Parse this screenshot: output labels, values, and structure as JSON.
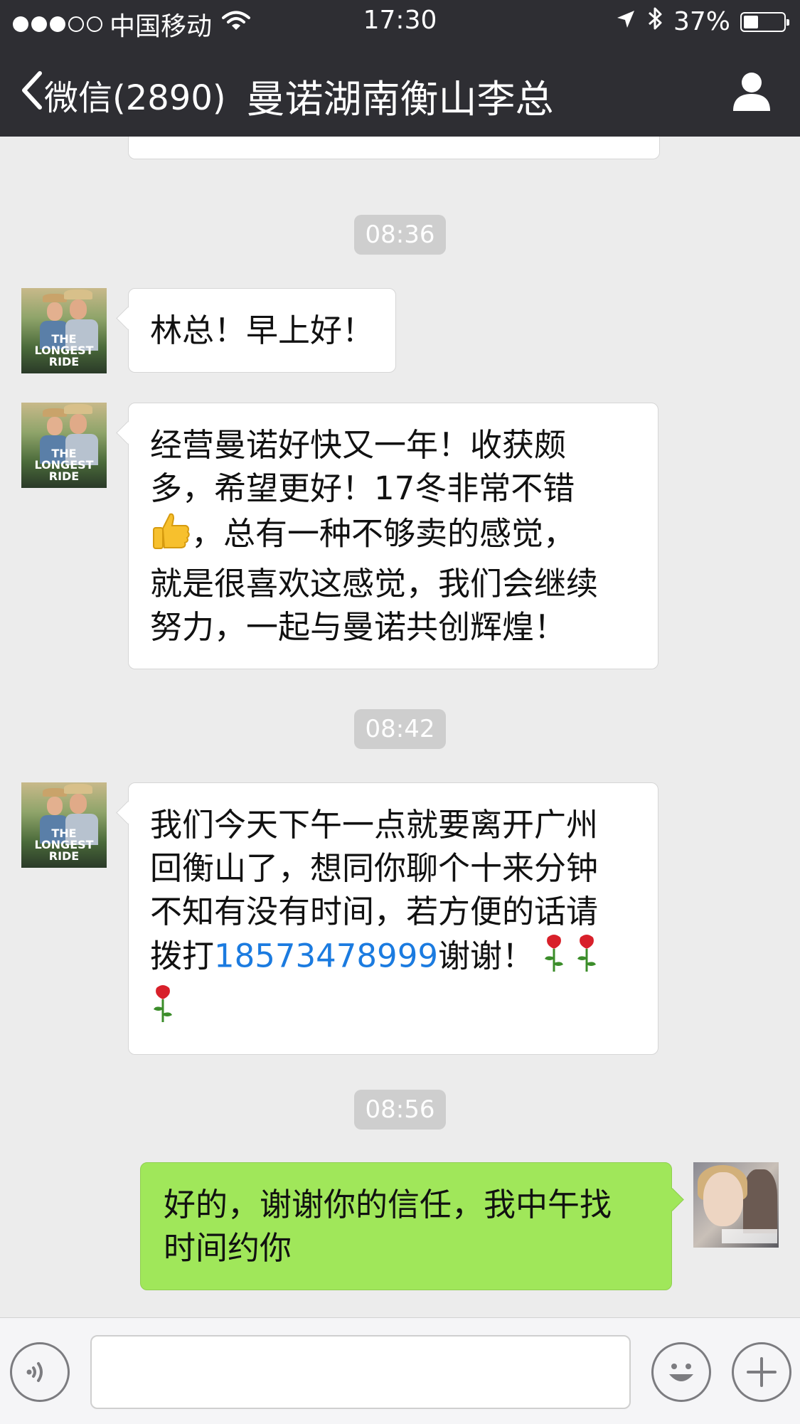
{
  "status_bar": {
    "carrier": "中国移动",
    "time": "17:30",
    "battery": "37%",
    "battery_level": 0.37
  },
  "nav": {
    "back_label": "微信(2890)",
    "title": "曼诺湖南衡山李总"
  },
  "messages": [
    {
      "type": "timestamp",
      "text": "08:36"
    },
    {
      "type": "incoming",
      "text": "林总！早上好！"
    },
    {
      "type": "incoming",
      "line1": "经营曼诺好快又一年！收获颇",
      "line2": "多，希望更好！17冬非常不错",
      "line3_after_emoji": "，总有一种不够卖的感觉，",
      "line4": "就是很喜欢这感觉，我们会继续",
      "line5": "努力，一起与曼诺共创辉煌！"
    },
    {
      "type": "timestamp",
      "text": "08:42"
    },
    {
      "type": "incoming",
      "line1": "我们今天下午一点就要离开广州",
      "line2": "回衡山了，想同你聊个十来分钟",
      "line3": "不知有没有时间，若方便的话请",
      "line4_prefix": "拨打",
      "phone": "18573478999",
      "line4_suffix": "谢谢！"
    },
    {
      "type": "timestamp",
      "text": "08:56"
    },
    {
      "type": "outgoing",
      "line1": "好的，谢谢你的信任，我中午找",
      "line2": "时间约你"
    }
  ],
  "avatar_caption": {
    "line1": "THE",
    "line2": "LONGEST",
    "line3": "RIDE"
  },
  "icons": {
    "back": "chevron-left-icon",
    "contact": "person-icon",
    "voice": "voice-icon",
    "emoji": "emoji-icon",
    "plus": "plus-icon",
    "thumbs_up": "thumbs-up-emoji",
    "rose": "rose-emoji"
  },
  "colors": {
    "header": "#2e2e33",
    "outgoing_bubble": "#a0e75a",
    "phone_link": "#1b7be0",
    "chat_bg": "#ececec"
  }
}
